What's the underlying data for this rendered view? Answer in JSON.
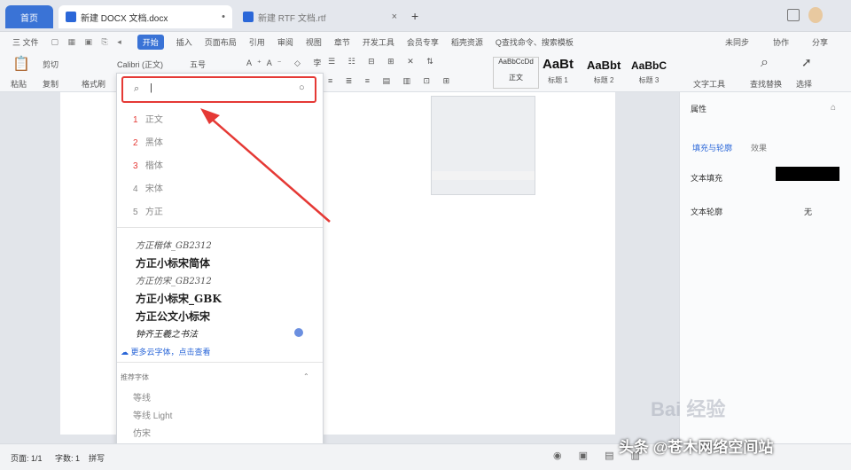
{
  "tabs": {
    "home": "首页",
    "doc1": "新建 DOCX 文档.docx",
    "doc2": "新建 RTF 文档.rtf",
    "new_tab": "+"
  },
  "menu": {
    "file": "三 文件",
    "items": [
      "开始",
      "插入",
      "页面布局",
      "引用",
      "审阅",
      "视图",
      "章节",
      "开发工具",
      "会员专享",
      "稻壳资源"
    ],
    "search": "Q查找命令、搜索模板",
    "right": [
      "未同步",
      "协作",
      "分享"
    ]
  },
  "ribbon": {
    "paste": "粘贴",
    "cut": "剪切",
    "copy": "复制",
    "format_painter": "格式刷",
    "font_name": "Calibri (正文)",
    "font_size": "五号",
    "styles": [
      {
        "preview": "AaBbCcDd",
        "label": "正文"
      },
      {
        "preview": "AaBt",
        "label": "标题 1"
      },
      {
        "preview": "AaBbt",
        "label": "标题 2"
      },
      {
        "preview": "AaBbC",
        "label": "标题 3"
      }
    ],
    "text_tools": "文字工具",
    "find_replace": "查找替换",
    "select": "选择"
  },
  "font_dropdown": {
    "search_placeholder": "|",
    "recent": [
      {
        "n": "1",
        "name": "正文"
      },
      {
        "n": "2",
        "name": "黑体"
      },
      {
        "n": "3",
        "name": "楷体"
      },
      {
        "n": "4",
        "name": "宋体"
      },
      {
        "n": "5",
        "name": "方正"
      }
    ],
    "fonts": [
      "方正楷体_GB2312",
      "方正小标宋简体",
      "方正仿宋_GB2312",
      "方正小标宋_GBK",
      "方正公文小标宋",
      "钟齐王羲之书法"
    ],
    "more_link": "更多云字体，点击查看",
    "section_label": "推荐字体",
    "recommended": [
      "等线",
      "等线 Light",
      "仿宋",
      "黑体"
    ]
  },
  "right_panel": {
    "title": "属性",
    "tab1": "填充与轮廓",
    "tab2": "效果",
    "row1": "文本填充",
    "row2": "文本轮廓",
    "row2_value": "无"
  },
  "status": {
    "page": "页面: 1/1",
    "words": "字数: 1",
    "spell": "拼写"
  },
  "watermark": {
    "baidu": "Bai 经验",
    "source": "头条 @苍木网络空间站"
  },
  "colors": {
    "accent": "#2b67d8",
    "highlight": "#e53935"
  }
}
